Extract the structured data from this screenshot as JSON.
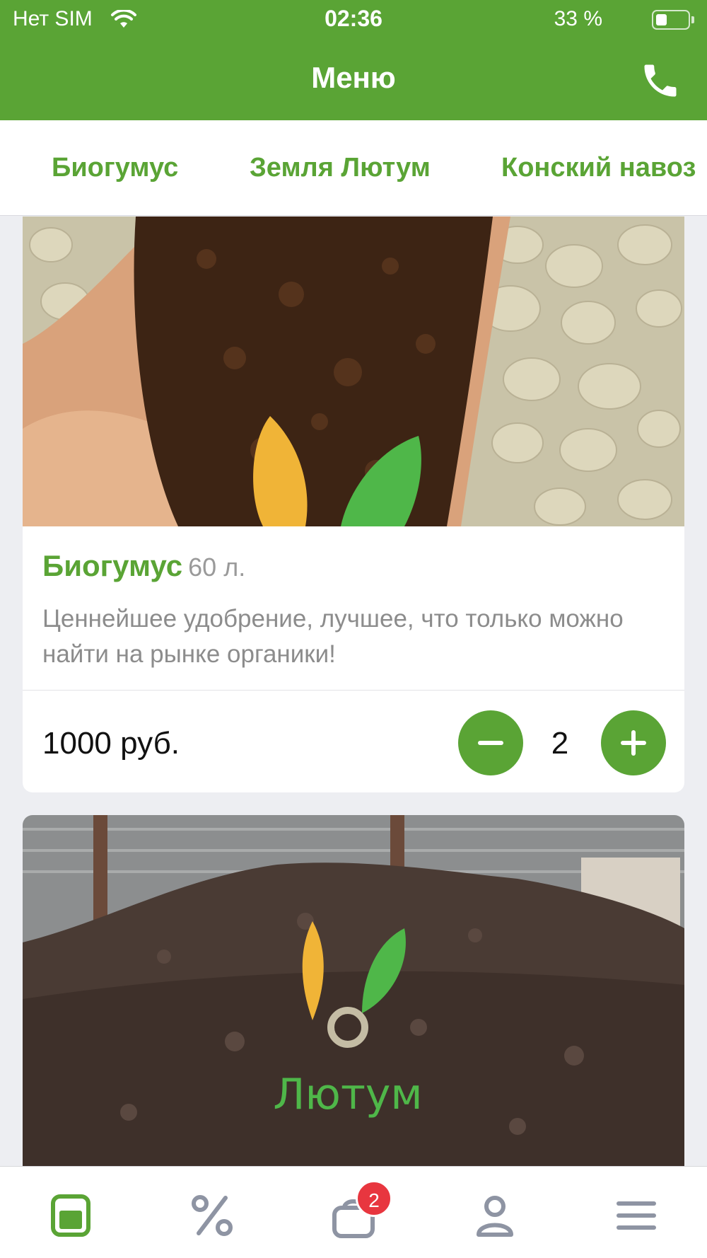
{
  "status_bar": {
    "carrier": "Нет SIM",
    "time": "02:36",
    "battery_percent": "33 %",
    "battery_level": 0.33
  },
  "header": {
    "title": "Меню",
    "phone_icon": "phone-icon"
  },
  "tabs": [
    "Биогумус",
    "Земля Лютум",
    "Конский навоз"
  ],
  "products": [
    {
      "name": "Биогумус",
      "volume": "60 л.",
      "description": "Ценнейшее удобрение, лучшее, что только можно найти на рынке органики!",
      "price": "1000 руб.",
      "quantity": "2"
    },
    {
      "logo_text": "Лютум"
    }
  ],
  "tabbar": {
    "items": [
      "menu-icon",
      "discount-icon",
      "cart-icon",
      "profile-icon",
      "more-icon"
    ],
    "active": "menu-icon",
    "cart_badge": "2"
  },
  "colors": {
    "primary": "#5aa435",
    "badge": "#e8363f",
    "inactive_icon": "#8e94a3"
  }
}
